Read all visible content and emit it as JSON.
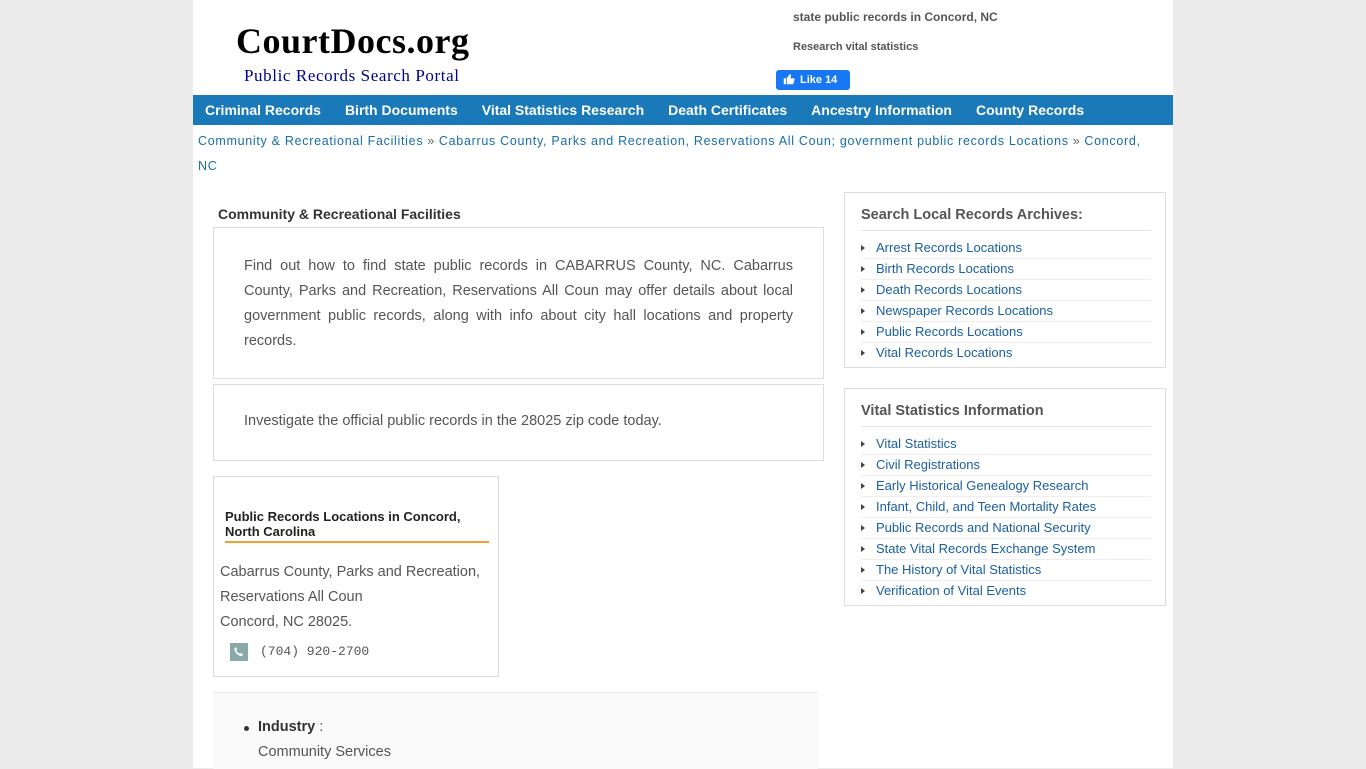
{
  "header": {
    "logo_title": "CourtDocs.org",
    "logo_subtitle": "Public Records Search Portal",
    "tagline_1": "state public records in Concord, NC",
    "tagline_2": "Research vital statistics",
    "fb_like_label": "Like 14",
    "fb_color": "#1877f2"
  },
  "nav": {
    "items": [
      "Criminal Records",
      "Birth Documents",
      "Vital Statistics Research",
      "Death Certificates",
      "Ancestry Information",
      "County Records"
    ],
    "color": "#1a7ab9"
  },
  "breadcrumb": {
    "items": [
      "Community & Recreational Facilities",
      "Cabarrus County, Parks and Recreation, Reservations All Coun; government public records Locations",
      "Concord, NC"
    ],
    "separator": "»"
  },
  "main": {
    "section_title": "Community & Recreational Facilities",
    "intro": "Find out how to find state public records in CABARRUS County, NC. Cabarrus County, Parks and Recreation, Reservations All Coun may offer details about local government public records, along with info about city hall locations and property records.",
    "zip_text": "Investigate the official public records in the 28025 zip code today.",
    "location_card": {
      "title": "Public Records Locations in Concord, North Carolina",
      "address_line_1": "Cabarrus County, Parks and Recreation,",
      "address_line_2": "Reservations All Coun",
      "address_line_3": "Concord, NC 28025.",
      "phone": "(704) 920-2700"
    },
    "industry": {
      "label": "Industry",
      "separator": " :",
      "value": "Community Services"
    }
  },
  "sidebar": {
    "archives": {
      "title": "Search Local Records Archives:",
      "links": [
        "Arrest Records Locations",
        "Birth Records Locations",
        "Death Records Locations",
        "Newspaper Records Locations",
        "Public Records Locations",
        "Vital Records Locations"
      ]
    },
    "vital": {
      "title": "Vital Statistics Information",
      "links": [
        "Vital Statistics",
        "Civil Registrations",
        "Early Historical Genealogy Research",
        "Infant, Child, and Teen Mortality Rates",
        "Public Records and National Security",
        "State Vital Records Exchange System",
        "The History of Vital Statistics",
        "Verification of Vital Events"
      ]
    },
    "link_color": "#1a5fa0"
  }
}
